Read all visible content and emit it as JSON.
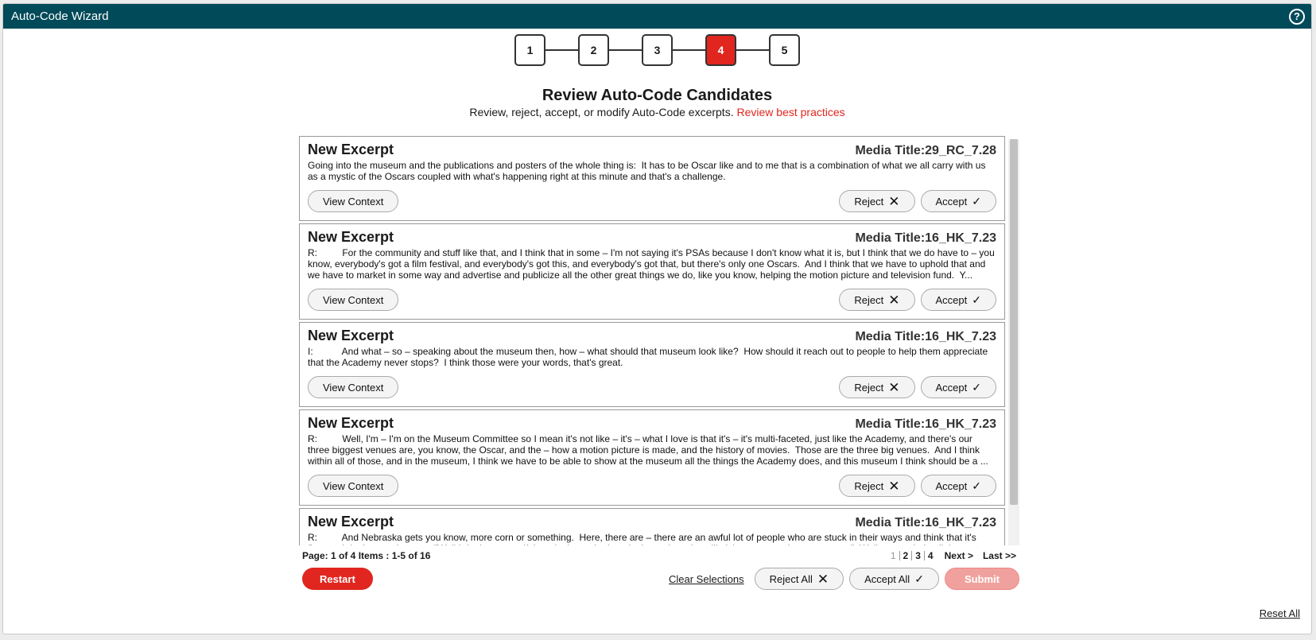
{
  "app": {
    "title": "Auto-Code Wizard"
  },
  "steps": [
    {
      "label": "1",
      "active": false
    },
    {
      "label": "2",
      "active": false
    },
    {
      "label": "3",
      "active": false
    },
    {
      "label": "4",
      "active": true
    },
    {
      "label": "5",
      "active": false
    }
  ],
  "header": {
    "heading": "Review Auto-Code Candidates",
    "subtext": "Review, reject, accept, or modify Auto-Code excerpts.",
    "link": "Review best practices"
  },
  "card_labels": {
    "view_context": "View Context",
    "reject": "Reject",
    "accept": "Accept"
  },
  "excerpts": [
    {
      "title": "New Excerpt",
      "media": "Media Title:29_RC_7.28",
      "text": "Going into the museum and the publications and posters of the whole thing is:  It has to be Oscar like and to me that is a combination of what we all carry with us as a mystic of the Oscars coupled with what's happening right at this minute and that's a challenge."
    },
    {
      "title": "New Excerpt",
      "media": "Media Title:16_HK_7.23",
      "text": "R:\t     For the community and stuff like that, and I think that in some – I'm not saying it's PSAs because I don't know what it is, but I think that we do have to – you know, everybody's got a film festival, and everybody's got this, and everybody's got that, but there's only one Oscars.  And I think that we have to uphold that and we have to market in some way and advertise and publicize all the other great things we do, like you know, helping the motion picture and television fund.  Y..."
    },
    {
      "title": "New Excerpt",
      "media": "Media Title:16_HK_7.23",
      "text": "I:\t     And what – so – speaking about the museum then, how – what should that museum look like?  How should it reach out to people to help them appreciate that the Academy never stops?  I think those were your words, that's great."
    },
    {
      "title": "New Excerpt",
      "media": "Media Title:16_HK_7.23",
      "text": "R:\t     Well, I'm – I'm on the Museum Committee so I mean it's not like – it's – what I love is that it's – it's multi-faceted, just like the Academy, and there's our three biggest venues are, you know, the Oscar, and the – how a motion picture is made, and the history of movies.  Those are the three big venues.  And I think within all of those, and in the museum, I think we have to be able to show at the museum all the things the Academy does, and this museum I think should be a ..."
    },
    {
      "title": "New Excerpt",
      "media": "Media Title:16_HK_7.23",
      "text": "R:\t     And Nebraska gets you know, more corn or something.  Here, there are – there are an awful lot of people who are stuck in their ways and think that it's fine, and don't care, they say, \"Well I don't care, so if they don't watch, they don't watch, we're still giving out awards to our peers.\"  Well, we can't do all the"
    }
  ],
  "pagination": {
    "info": "Page: 1 of 4 Items : 1-5 of 16",
    "pages": [
      "1",
      "2",
      "3",
      "4"
    ],
    "next": "Next >",
    "last": "Last >>"
  },
  "footer": {
    "restart": "Restart",
    "clear": "Clear Selections",
    "reject_all": "Reject All",
    "accept_all": "Accept All",
    "submit": "Submit",
    "reset_all": "Reset All"
  },
  "colors": {
    "titlebar": "#004a59",
    "accent": "#e0261f",
    "submit_disabled": "#f0a19d"
  }
}
